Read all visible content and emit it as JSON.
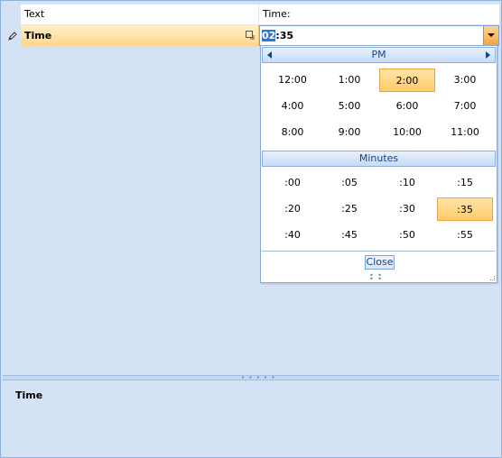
{
  "grid": {
    "columns": [
      "Text",
      "Time:"
    ],
    "row": {
      "label": "Time",
      "time_selected_part": "02",
      "time_rest": ":35"
    }
  },
  "picker": {
    "period": "PM",
    "hours": [
      "12:00",
      "1:00",
      "2:00",
      "3:00",
      "4:00",
      "5:00",
      "6:00",
      "7:00",
      "8:00",
      "9:00",
      "10:00",
      "11:00"
    ],
    "selected_hour": "2:00",
    "minutes_label": "Minutes",
    "minutes": [
      ":00",
      ":05",
      ":10",
      ":15",
      ":20",
      ":25",
      ":30",
      ":35",
      ":40",
      ":45",
      ":50",
      ":55"
    ],
    "selected_minute": ":35",
    "close_label": "Close",
    "resize_dots": "• • • •"
  },
  "splitter": {
    "dots": "• • • • •"
  },
  "description": {
    "title": "Time"
  },
  "colors": {
    "background": "#d4e2f6",
    "selection_orange": "#ffcc6b",
    "accent_blue": "#15428b"
  }
}
